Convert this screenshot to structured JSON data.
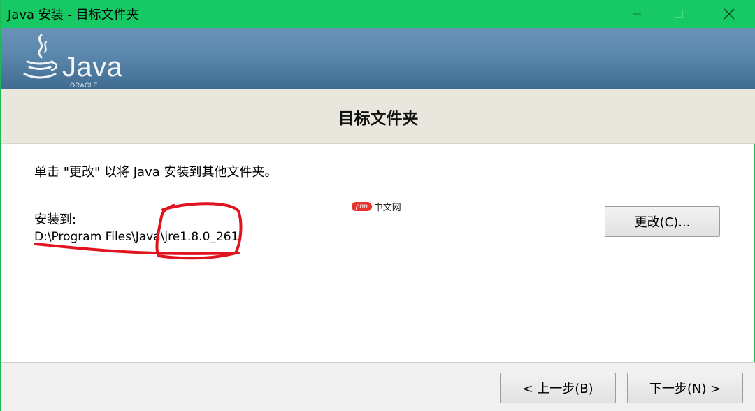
{
  "window": {
    "title": "Java 安装 - 目标文件夹",
    "controls": {
      "minimize": "minimize",
      "maximize": "maximize",
      "close": "close"
    }
  },
  "banner": {
    "logo_word": "Java",
    "logo_sub": "ORACLE"
  },
  "page": {
    "heading": "目标文件夹",
    "instruction": "单击 \"更改\" 以将 Java 安装到其他文件夹。",
    "install_label": "安装到:",
    "install_path": "D:\\Program Files\\Java\\jre1.8.0_261",
    "change_button": "更改(C)..."
  },
  "watermark": {
    "badge": "php",
    "text": "中文网"
  },
  "footer": {
    "back_button": "< 上一步(B)",
    "next_button": "下一步(N) >"
  },
  "colors": {
    "titlebar": "#17c964",
    "banner_top": "#6992b6",
    "banner_bottom": "#3f6b90",
    "heading_strip": "#e9e7dd",
    "annotation": "#e0141e"
  }
}
